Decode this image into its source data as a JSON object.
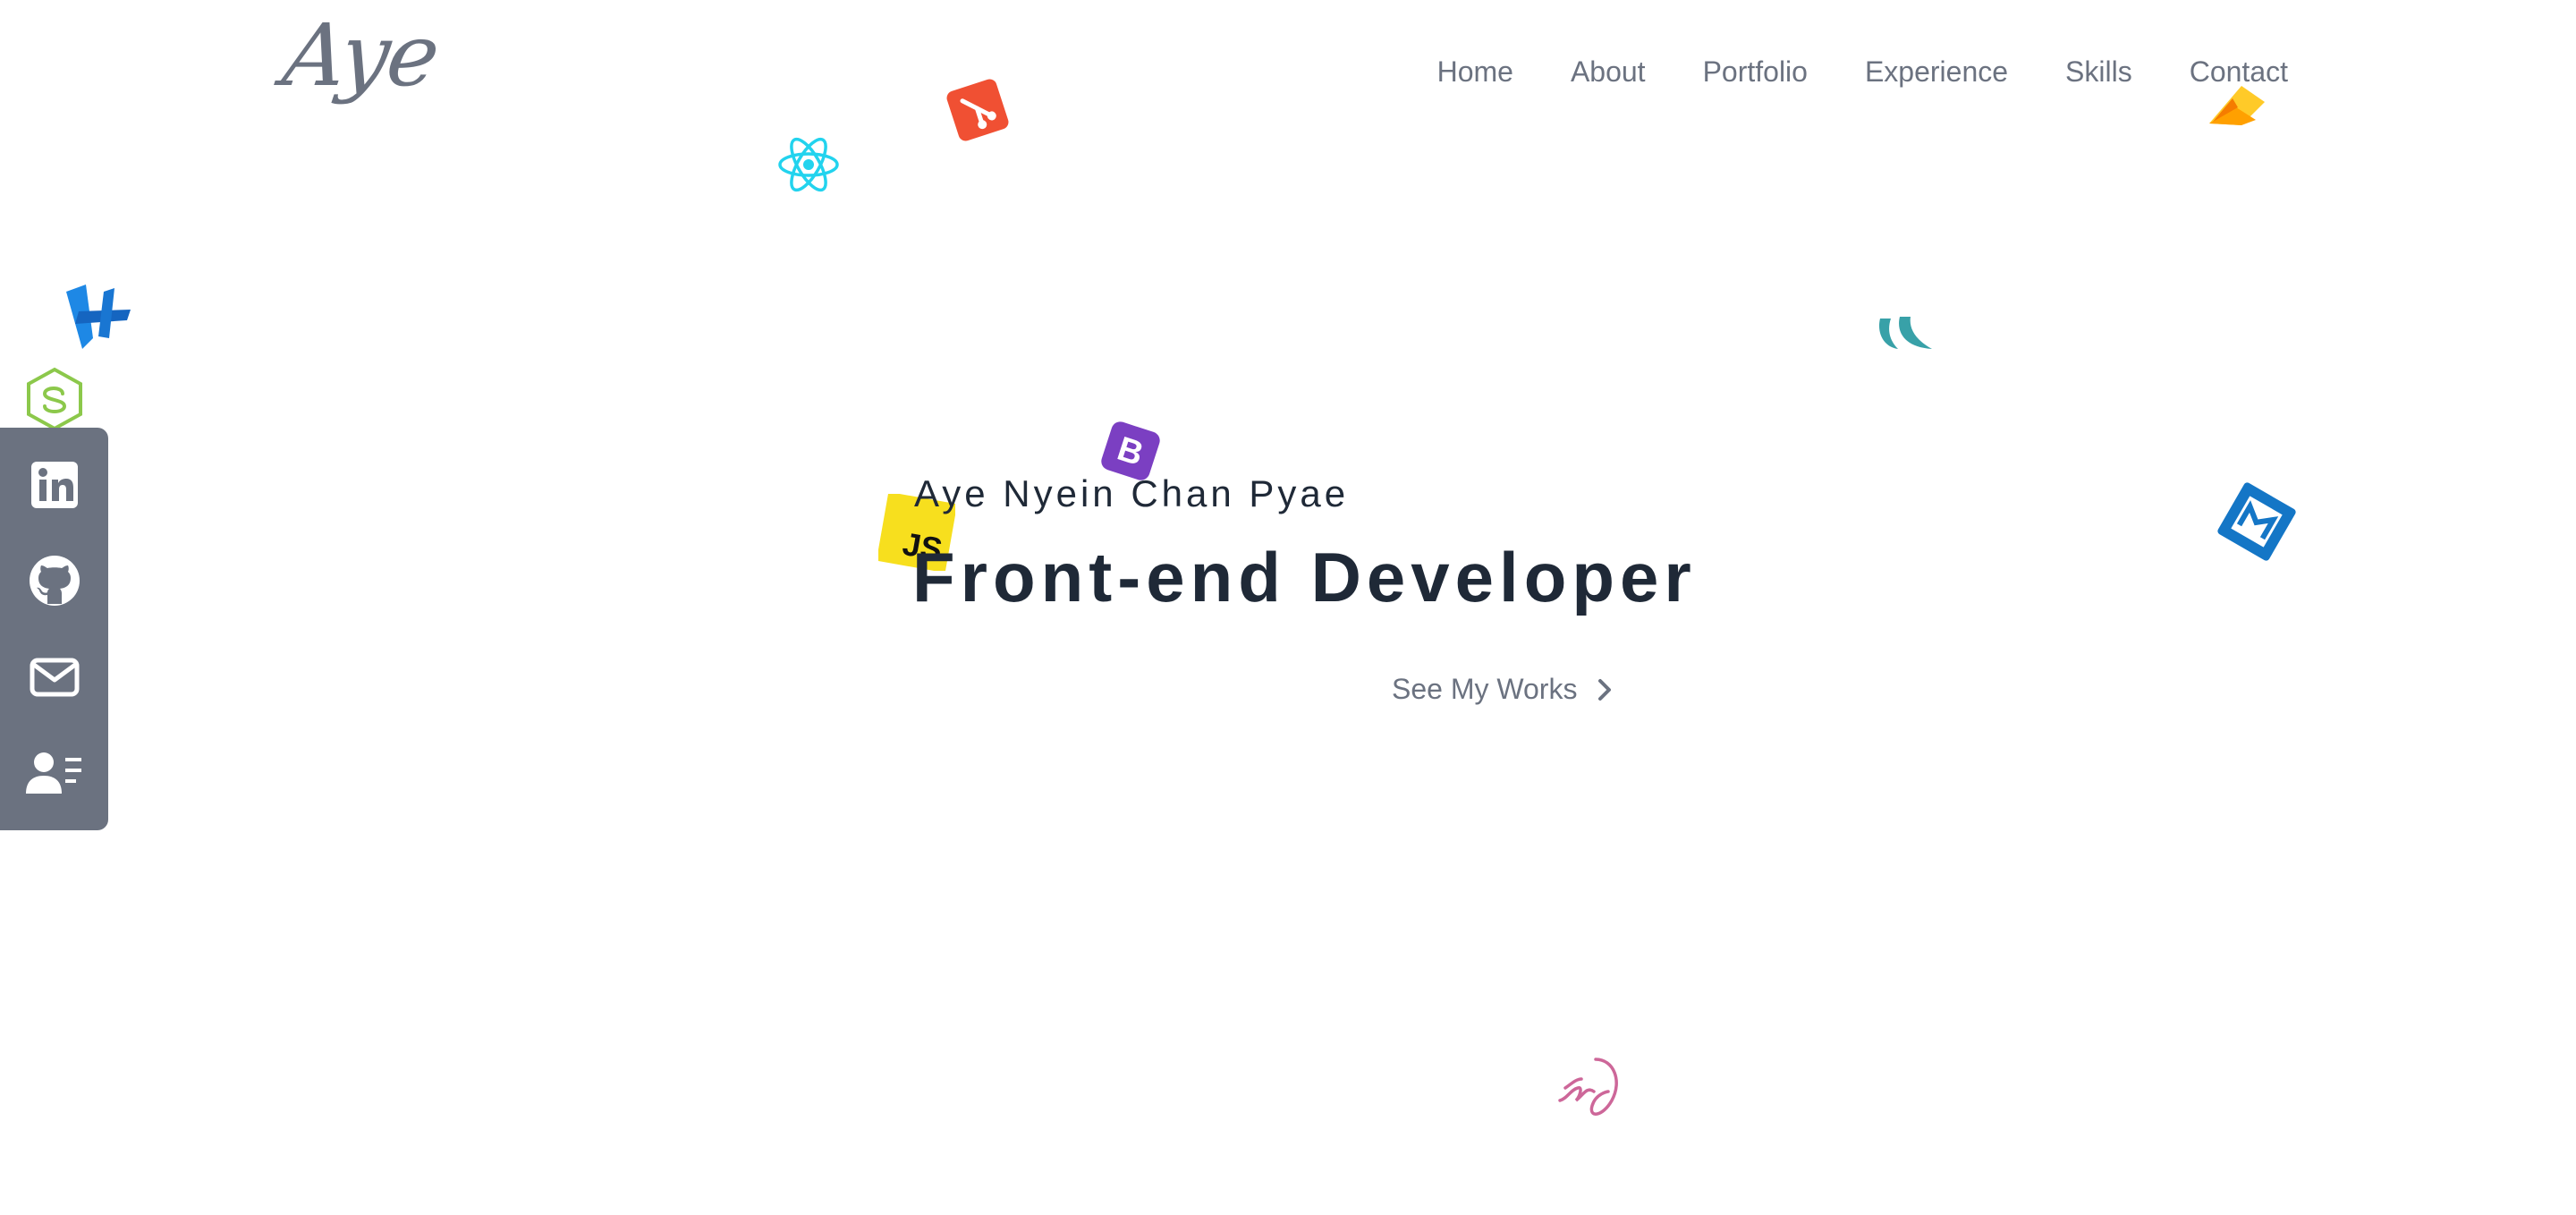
{
  "header": {
    "logo_text": "Aye",
    "nav": [
      "Home",
      "About",
      "Portfolio",
      "Experience",
      "Skills",
      "Contact"
    ]
  },
  "hero": {
    "name": "Aye Nyein Chan Pyae",
    "title": "Front-end Developer",
    "cta_label": "See My Works"
  },
  "social": [
    {
      "name": "linkedin-icon"
    },
    {
      "name": "github-icon"
    },
    {
      "name": "mail-icon"
    },
    {
      "name": "resume-icon"
    }
  ],
  "icons": {
    "js_label": "JS",
    "bootstrap_label": "B"
  },
  "colors": {
    "text_dark": "#1f2937",
    "text_muted": "#6b7280",
    "sidebar_bg": "#6b7280",
    "react": "#22d3ee",
    "git": "#f05033",
    "js": "#f7df1e",
    "bootstrap": "#7b3fc2",
    "vscode": "#1e88e5",
    "nodejs": "#8cc84b",
    "firebase": "#ffa000",
    "mui": "#1476c6",
    "sass": "#cd6799",
    "wind": "#38a1a8"
  }
}
